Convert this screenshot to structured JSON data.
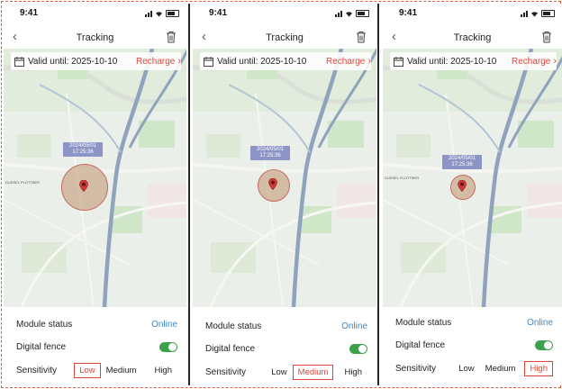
{
  "screens": [
    {
      "status_time": "9:41",
      "title": "Tracking",
      "valid_text": "Valid until: 2025-10-10",
      "recharge": "Recharge",
      "timestamp_date": "2024/05/01",
      "timestamp_time": "17:25:36",
      "module_status_label": "Module status",
      "module_status_value": "Online",
      "digital_fence_label": "Digital fence",
      "digital_fence_on": true,
      "sensitivity_label": "Sensitivity",
      "sensitivity_options": [
        "Low",
        "Medium",
        "High"
      ],
      "sensitivity_selected": "Low"
    },
    {
      "status_time": "9:41",
      "title": "Tracking",
      "valid_text": "Valid until: 2025-10-10",
      "recharge": "Recharge",
      "timestamp_date": "2024/05/01",
      "timestamp_time": "17:25:36",
      "module_status_label": "Module status",
      "module_status_value": "Online",
      "digital_fence_label": "Digital fence",
      "digital_fence_on": true,
      "sensitivity_label": "Sensitivity",
      "sensitivity_options": [
        "Low",
        "Medium",
        "High"
      ],
      "sensitivity_selected": "Medium"
    },
    {
      "status_time": "9:41",
      "title": "Tracking",
      "valid_text": "Valid until: 2025-10-10",
      "recharge": "Recharge",
      "timestamp_date": "2024/05/01",
      "timestamp_time": "17:25:36",
      "module_status_label": "Module status",
      "module_status_value": "Online",
      "digital_fence_label": "Digital fence",
      "digital_fence_on": true,
      "sensitivity_label": "Sensitivity",
      "sensitivity_options": [
        "Low",
        "Medium",
        "High"
      ],
      "sensitivity_selected": "High"
    }
  ],
  "colors": {
    "recharge": "#e0453a",
    "online": "#3f88c5",
    "toggle_on": "#3aa34a",
    "selected_border": "#e0453a",
    "timestamp_bg": "#8d95c6",
    "frame_dash": "#d9603a"
  },
  "icons": [
    "back-icon",
    "trash-icon",
    "calendar-icon",
    "chevron-right-icon",
    "signal-icon",
    "wifi-icon",
    "battery-icon",
    "location-pin-icon"
  ]
}
